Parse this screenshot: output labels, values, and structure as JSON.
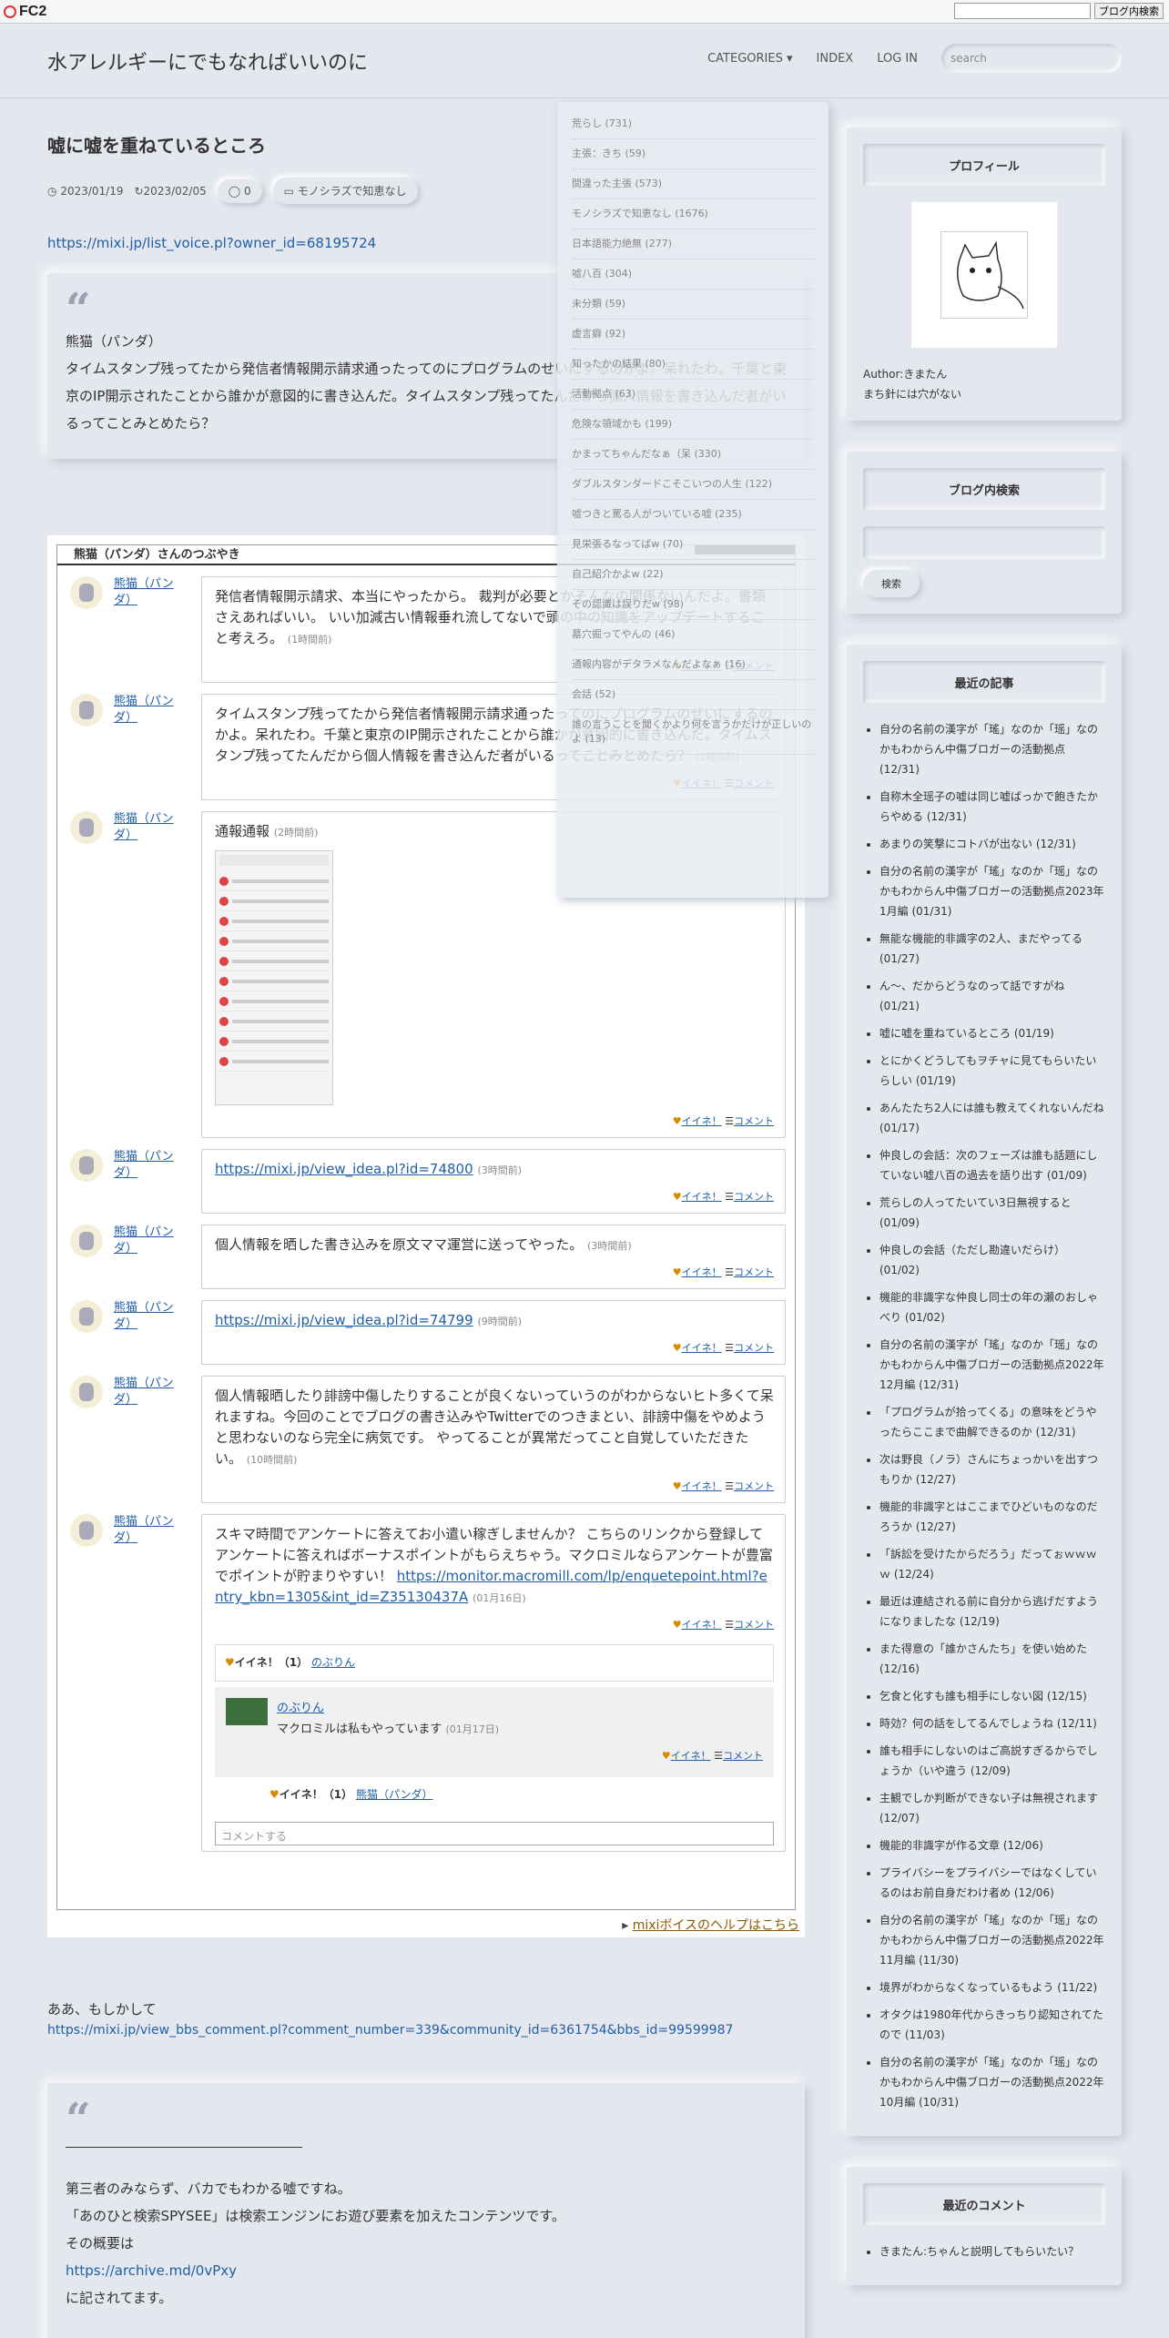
{
  "fc2": {
    "logo": "FC2",
    "search_button": "ブログ内検索"
  },
  "site": {
    "title": "水アレルギーにでもなればいいのに"
  },
  "nav": {
    "categories": "CATEGORIES",
    "index": "INDEX",
    "login": "LOG IN",
    "search_placeholder": "search"
  },
  "post": {
    "title": "嘘に嘘を重ねているところ",
    "created": "2023/01/19",
    "updated": "2023/02/05",
    "comments": "0",
    "category": "モノシラズで知恵なし",
    "link1": "https://mixi.jp/list_voice.pl?owner_id=68195724",
    "quote1": [
      "熊猫（パンダ）",
      "タイムスタンプ残ってたから発信者情報開示請求通ったってのにプログラムのせいにするのかよ。呆れたわ。千葉と東京のIP開示されたことから誰かが意図的に書き込んだ。タイムスタンプ残ってたんだから個人情報を書き込んだ者がいるってことみとめたら？"
    ],
    "text2": "ああ、もしかして",
    "link2": "https://mixi.jp/view_bbs_comment.pl?comment_number=339&community_id=6361754&bbs_id=99599987",
    "quote2_lines": [
      "第三者のみならず、バカでもわかる嘘ですね。",
      "「あのひと検索SPYSEE」は検索エンジンにお遊び要素を加えたコンテンツです。",
      "その概要は",
      "https://archive.md/0vPxy",
      "に記されてます。"
    ]
  },
  "widget": {
    "head": "熊猫（パンダ）さんのつぶやき",
    "user": "熊猫（パンダ）",
    "iine": "イイネ！",
    "comment": "コメント",
    "entries": [
      {
        "text": "発信者情報開示請求、本当にやったから。 裁判が必要とかそんなの関係ないんだよ。書類さえあればいい。 いい加減古い情報垂れ流してないで頭の中の知識をアップデートすること考えろ。",
        "time": "(1時間前)"
      },
      {
        "text": "タイムスタンプ残ってたから発信者情報開示請求通ったってのにプログラムのせいにするのかよ。呆れたわ。千葉と東京のIP開示されたことから誰かが意図的に書き込んだ。タイムスタンプ残ってたんだから個人情報を書き込んだ者がいるってことみとめたら？",
        "time": "(2時間前)"
      },
      {
        "text": "通報通報",
        "time": "(2時間前)"
      },
      {
        "text": "https://mixi.jp/view_idea.pl?id=74800",
        "time": "(3時間前)"
      },
      {
        "text": "個人情報を晒した書き込みを原文ママ運営に送ってやった。",
        "time": "(3時間前)"
      },
      {
        "text": "https://mixi.jp/view_idea.pl?id=74799",
        "time": "(9時間前)"
      },
      {
        "text": "個人情報晒したり誹謗中傷したりすることが良くないっていうのがわからないヒト多くて呆れますね。今回のことでブログの書き込みやTwitterでのつきまとい、誹謗中傷をやめようと思わないのなら完全に病気です。 やってることが異常だってこと自覚していただきたい。",
        "time": "(10時間前)"
      },
      {
        "text": "スキマ時間でアンケートに答えてお小遣い稼ぎしませんか？ こちらのリンクから登録してアンケートに答えればボーナスポイントがもらえちゃう。マクロミルならアンケートが豊富でポイントが貯まりやすい！ ",
        "link": "https://monitor.macromill.com/lp/enquetepoint.html?entry_kbn=1305&int_id=Z35130437A",
        "time": "(01月16日)"
      }
    ],
    "sub": {
      "iine_count": "イイネ！（1）",
      "liker": "のぶりん",
      "reply_user": "のぶりん",
      "reply_text": "マクロミルは私もやっています",
      "reply_time": "(01月17日)",
      "reply_iine_count": "イイネ！（1）",
      "reply_liker": "熊猫（パンダ）",
      "comment_placeholder": "コメントする"
    },
    "help": "mixiボイスのヘルプはこちら"
  },
  "sidebar": {
    "profile_title": "プロフィール",
    "author": "Author:きまたん",
    "author_note": "まち針には穴がない",
    "search_title": "ブログ内検索",
    "search_button": "検索",
    "recent_title": "最近の記事",
    "recent": [
      "自分の名前の漢字が「瑤」なのか「瑶」なのかもわからん中傷ブロガーの活動拠点 (12/31)",
      "自称木全瑶子の嘘は同じ嘘ばっかで飽きたからやめる (12/31)",
      "あまりの笑撃にコトバが出ない (12/31)",
      "自分の名前の漢字が「瑤」なのか「瑶」なのかもわからん中傷ブロガーの活動拠点2023年1月編 (01/31)",
      "無能な機能的非識字の2人、まだやってる (01/27)",
      "ん〜、だからどうなのって話ですがね (01/21)",
      "嘘に嘘を重ねているところ (01/19)",
      "とにかくどうしてもヲチャに見てもらいたいらしい (01/19)",
      "あんたたち2人には誰も教えてくれないんだね (01/17)",
      "仲良しの会話：次のフェーズは誰も話題にしていない嘘八百の過去を語り出す (01/09)",
      "荒らしの人ってたいてい3日無視すると (01/09)",
      "仲良しの会話（ただし勘違いだらけ） (01/02)",
      "機能的非識字な仲良し同士の年の瀬のおしゃべり (01/02)",
      "自分の名前の漢字が「瑤」なのか「瑶」なのかもわからん中傷ブロガーの活動拠点2022年12月編 (12/31)",
      "「プログラムが拾ってくる」の意味をどうやったらここまで曲解できるのか (12/31)",
      "次は野良（ノラ）さんにちょっかいを出すつもりか (12/27)",
      "機能的非識字とはここまでひどいものなのだろうか (12/27)",
      "「訴訟を受けたからだろう」だってぉｗｗｗｗ (12/24)",
      "最近は連結される前に自分から逃げだすようになりましたな (12/19)",
      "また得意の「誰かさんたち」を使い始めた (12/16)",
      "乞食と化すも誰も相手にしない図 (12/15)",
      "時効？何の話をしてるんでしょうね (12/11)",
      "誰も相手にしないのはご高説すぎるからでしょうか（いや違う (12/09)",
      "主観でしか判断ができない子は無視されます (12/07)",
      "機能的非識字が作る文章 (12/06)",
      "プライバシーをプライバシーではなくしているのはお前自身だわけ者め (12/06)",
      "自分の名前の漢字が「瑤」なのか「瑶」なのかもわからん中傷ブロガーの活動拠点2022年11月編 (11/30)",
      "境界がわからなくなっているもよう (11/22)",
      "オタクは1980年代からきっちり認知されてたので (11/03)",
      "自分の名前の漢字が「瑤」なのか「瑶」なのかもわからん中傷ブロガーの活動拠点2022年10月編 (10/31)"
    ],
    "comments_title": "最近のコメント",
    "comment_first": "きまたん:ちゃんと説明してもらいたい？"
  },
  "categories_menu": [
    "荒らし (731)",
    "主張：きち (59)",
    "間違った主張 (573)",
    "モノシラズで知恵なし (1676)",
    "日本語能力絶無 (277)",
    "嘘八百 (304)",
    "未分類 (59)",
    "虚言癖 (92)",
    "知ったかの結果 (80)",
    "活動拠点 (63)",
    "危険な領域かも (199)",
    "かまってちゃんだなぁ（呆 (330)",
    "ダブルスタンダードこそこいつの人生 (122)",
    "嘘つきと罵る人がついている嘘 (235)",
    "見栄張るなってばw (70)",
    "自己紹介かよw (22)",
    "その認識は誤りだw (98)",
    "墓穴掘ってやんの (46)",
    "通報内容がデタラメなんだよなぁ (16)",
    "会話 (52)",
    "誰の言うことを聞くかより何を言うかだけが正しいのよ (13)"
  ]
}
